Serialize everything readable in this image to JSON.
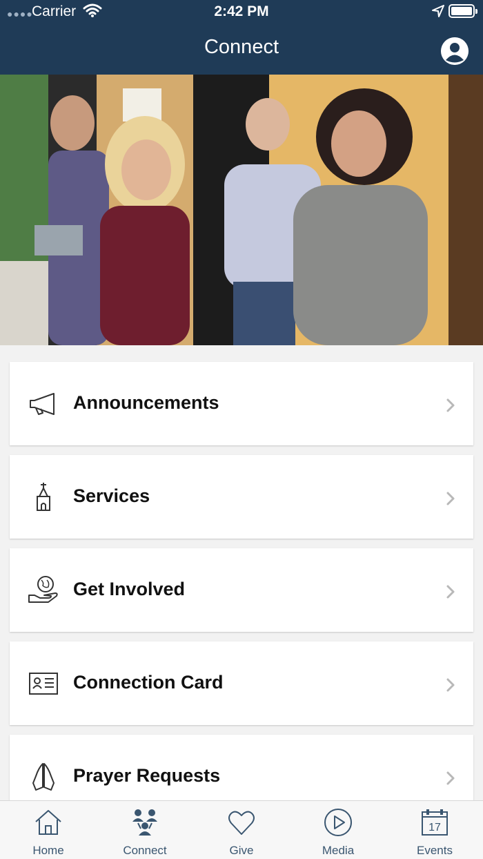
{
  "status_bar": {
    "carrier": "Carrier",
    "time": "2:42 PM"
  },
  "nav": {
    "title": "Connect",
    "profile_icon": "person-circle-icon"
  },
  "hero": {
    "description_icon": "group-photo"
  },
  "menu": {
    "items": [
      {
        "label": "Announcements",
        "icon": "megaphone-icon"
      },
      {
        "label": "Services",
        "icon": "church-icon"
      },
      {
        "label": "Get Involved",
        "icon": "globe-in-hand-icon"
      },
      {
        "label": "Connection Card",
        "icon": "id-card-icon"
      },
      {
        "label": "Prayer Requests",
        "icon": "praying-hands-icon"
      }
    ]
  },
  "tabs": [
    {
      "label": "Home",
      "icon": "house-icon"
    },
    {
      "label": "Connect",
      "icon": "people-icon"
    },
    {
      "label": "Give",
      "icon": "heart-icon"
    },
    {
      "label": "Media",
      "icon": "play-icon"
    },
    {
      "label": "Events",
      "icon": "calendar-icon",
      "day": "17"
    }
  ],
  "colors": {
    "header_bg": "#1f3b57",
    "tab_label": "#3a5670",
    "page_bg": "#f2f2f2"
  }
}
